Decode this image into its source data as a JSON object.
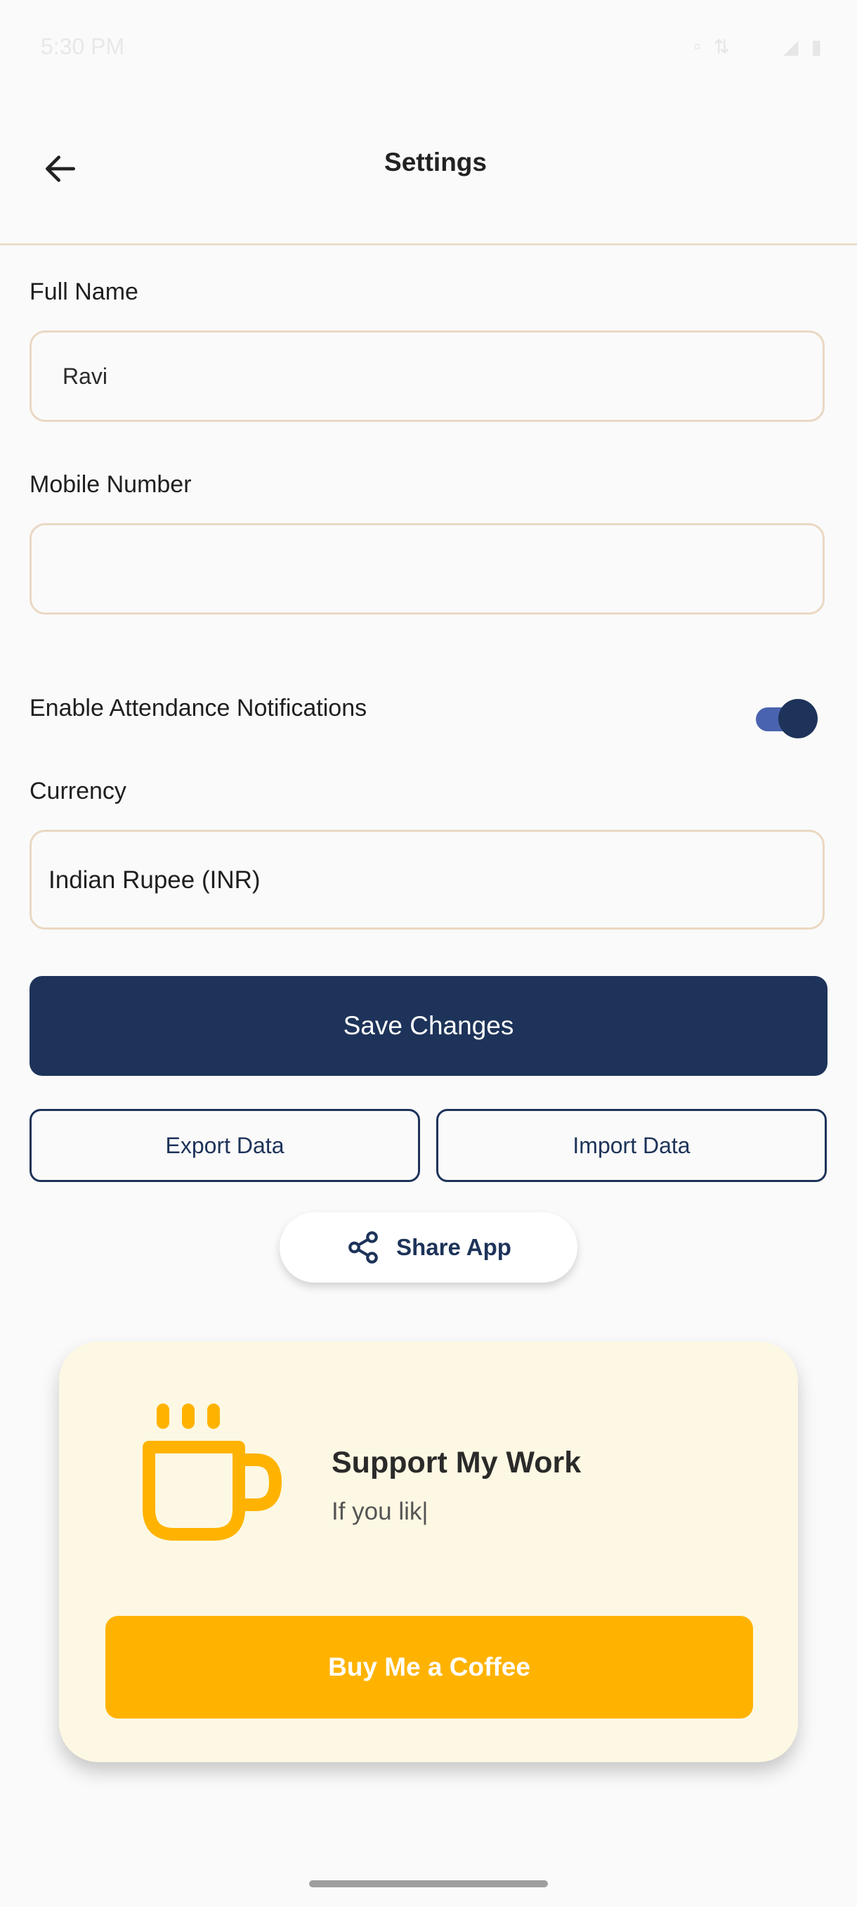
{
  "header": {
    "title": "Settings"
  },
  "form": {
    "full_name": {
      "label": "Full Name",
      "value": "Ravi",
      "placeholder": ""
    },
    "mobile_number": {
      "label": "Mobile Number",
      "value": "",
      "placeholder": ""
    },
    "notifications": {
      "label": "Enable Attendance Notifications",
      "enabled": true
    },
    "currency": {
      "label": "Currency",
      "value": "Indian Rupee (INR)"
    }
  },
  "actions": {
    "save_label": "Save Changes",
    "export_label": "Export Data",
    "import_label": "Import Data",
    "share_label": "Share App"
  },
  "support": {
    "title": "Support My Work",
    "subtitle": "If you lik|",
    "button_label": "Buy Me a Coffee"
  },
  "colors": {
    "primary": "#1d3359",
    "accent": "#ffb300",
    "card_bg": "#fdf8e3",
    "field_border": "#ead8c2",
    "toggle_track": "#4a63b0"
  },
  "icons": {
    "back": "arrow-left-icon",
    "share": "share-icon",
    "cup": "coffee-cup-icon"
  }
}
